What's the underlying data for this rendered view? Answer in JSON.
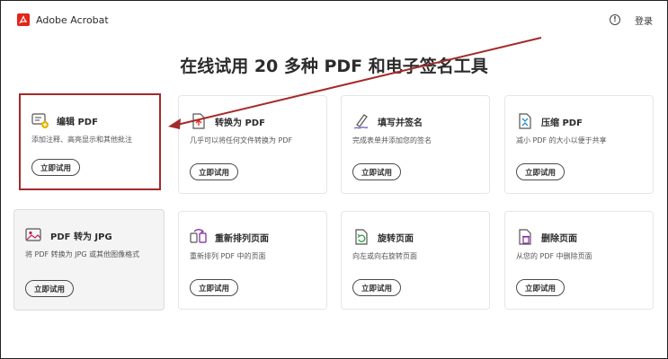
{
  "header": {
    "brand": "Adobe Acrobat",
    "login": "登录",
    "icons": {
      "logo": "adobe-logo",
      "help": "help-circle-icon"
    },
    "brand_color": "#e1251b"
  },
  "main": {
    "title": "在线试用 20 多种 PDF 和电子签名工具",
    "button_label": "立即试用",
    "tools": [
      {
        "title": "编辑 PDF",
        "desc": "添加注释、高亮显示和其他批注",
        "icon": "edit-pdf-icon"
      },
      {
        "title": "转换为 PDF",
        "desc": "几乎可以将任何文件转换为 PDF",
        "icon": "convert-to-pdf-icon"
      },
      {
        "title": "填写并签名",
        "desc": "完成表单并添加您的签名",
        "icon": "fill-sign-icon"
      },
      {
        "title": "压缩 PDF",
        "desc": "减小 PDF 的大小以便于共享",
        "icon": "compress-pdf-icon"
      },
      {
        "title": "PDF 转为 JPG",
        "desc": "将 PDF 转换为 JPG 或其他图像格式",
        "icon": "pdf-to-jpg-icon"
      },
      {
        "title": "重新排列页面",
        "desc": "重新排列 PDF 中的页面",
        "icon": "reorder-pages-icon"
      },
      {
        "title": "旋转页面",
        "desc": "向左或向右旋转页面",
        "icon": "rotate-pages-icon"
      },
      {
        "title": "删除页面",
        "desc": "从您的 PDF 中删除页面",
        "icon": "delete-pages-icon"
      }
    ]
  },
  "annotation": {
    "color": "#a52a2a"
  }
}
